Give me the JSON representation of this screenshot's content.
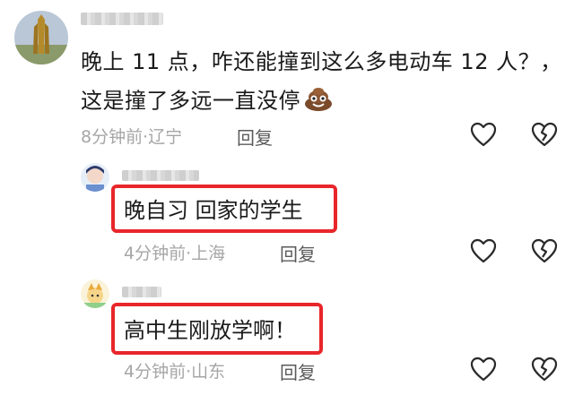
{
  "main_comment": {
    "text_line1": "晚上 11 点，咋还能撞到这么多电动车 12 人？，",
    "text_line2": "这是撞了多远一直没停",
    "emoji": "poop-face-emoji",
    "time": "8分钟前",
    "separator": "·",
    "location": "辽宁",
    "reply_label": "回复"
  },
  "replies": [
    {
      "text": "晚自习 回家的学生",
      "time": "4分钟前",
      "separator": "·",
      "location": "上海",
      "reply_label": "回复"
    },
    {
      "text": "高中生刚放学啊！",
      "time": "4分钟前",
      "separator": "·",
      "location": "山东",
      "reply_label": "回复"
    }
  ],
  "icons": {
    "like": "heart-outline-icon",
    "dislike": "broken-heart-icon"
  },
  "colors": {
    "highlight": "#e8262a",
    "meta": "#a6a6a6",
    "reply": "#5a5a5a"
  }
}
